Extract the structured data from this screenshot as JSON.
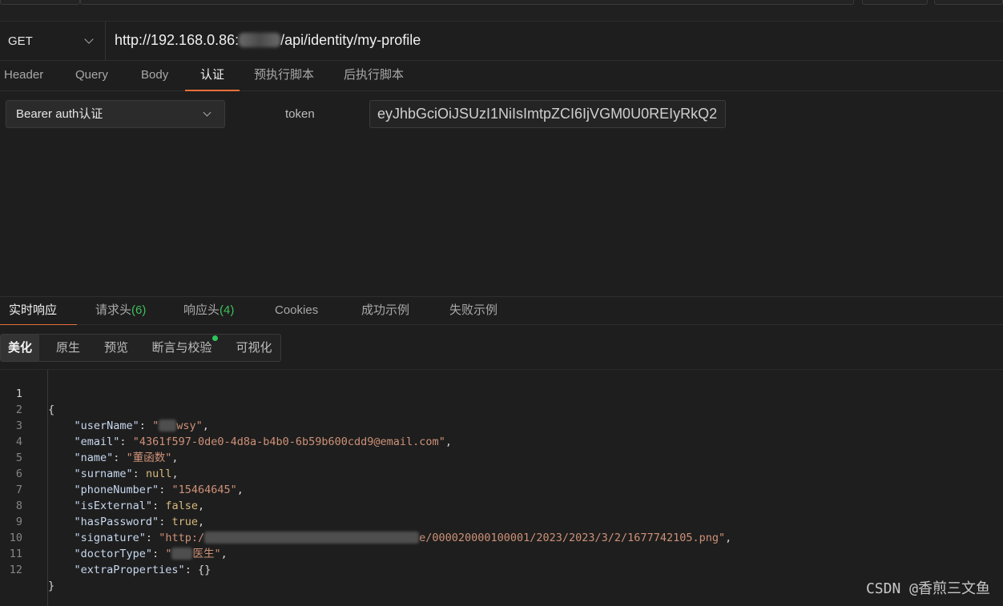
{
  "request": {
    "method": "GET",
    "url_prefix": "http://192.168.0.86:",
    "url_suffix": "/api/identity/my-profile"
  },
  "request_tabs": [
    "Header",
    "Query",
    "Body",
    "认证",
    "预执行脚本",
    "后执行脚本"
  ],
  "request_active_tab": "认证",
  "auth": {
    "type": "Bearer auth认证",
    "token_label": "token",
    "token_value": "eyJhbGciOiJSUzI1NiIsImtpZCI6IjVGM0U0REIyRkQ2"
  },
  "response_tabs": [
    {
      "label": "实时响应",
      "count": ""
    },
    {
      "label": "请求头",
      "count": "(6)"
    },
    {
      "label": "响应头",
      "count": "(4)"
    },
    {
      "label": "Cookies",
      "count": ""
    },
    {
      "label": "成功示例",
      "count": ""
    },
    {
      "label": "失败示例",
      "count": ""
    }
  ],
  "response_active_tab": "实时响应",
  "view_buttons": [
    "美化",
    "原生",
    "预览",
    "断言与校验",
    "可视化"
  ],
  "view_active": "美化",
  "code": {
    "line_numbers": [
      "1",
      "2",
      "3",
      "4",
      "5",
      "6",
      "7",
      "8",
      "9",
      "10",
      "11",
      "12"
    ],
    "open_brace": "{",
    "close_brace": "}",
    "fields": {
      "userName": {
        "key": "\"userName\"",
        "value_prefix": "\"",
        "value_suffix": "wsy\""
      },
      "email": {
        "key": "\"email\"",
        "value": "\"4361f597-0de0-4d8a-b4b0-6b59b600cdd9@email.com\""
      },
      "name": {
        "key": "\"name\"",
        "value": "\"董函数\""
      },
      "surname": {
        "key": "\"surname\"",
        "value": "null"
      },
      "phoneNumber": {
        "key": "\"phoneNumber\"",
        "value": "\"15464645\""
      },
      "isExternal": {
        "key": "\"isExternal\"",
        "value": "false"
      },
      "hasPassword": {
        "key": "\"hasPassword\"",
        "value": "true"
      },
      "signature": {
        "key": "\"signature\"",
        "value_prefix": "\"http:/",
        "value_suffix": "e/000020000100001/2023/2023/3/2/1677742105.png\""
      },
      "doctorType": {
        "key": "\"doctorType\"",
        "value_prefix": "\"",
        "value_suffix": "医生\""
      },
      "extraProperties": {
        "key": "\"extraProperties\"",
        "value": "{}"
      }
    }
  },
  "watermark": "CSDN @香煎三文鱼",
  "colors": {
    "accent": "#e8703a",
    "count_green": "#3fbf5a",
    "string": "#ce9178",
    "keyword": "#d7ba7d"
  }
}
